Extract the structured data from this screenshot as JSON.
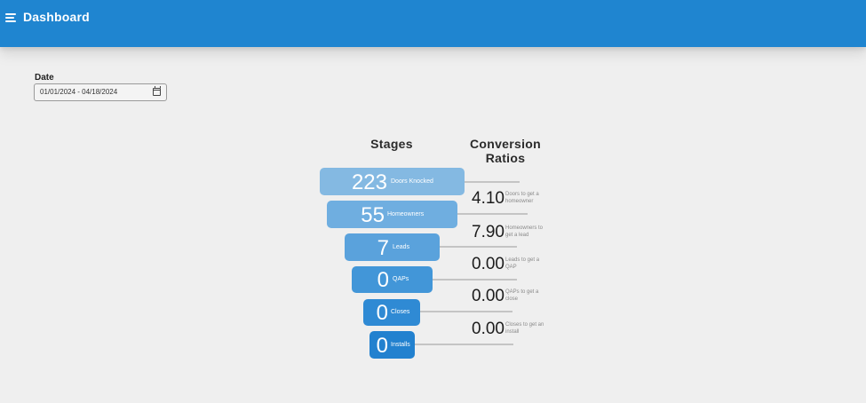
{
  "header": {
    "title": "Dashboard"
  },
  "filter": {
    "date_label": "Date",
    "date_value": "01/01/2024 - 04/18/2024"
  },
  "stages_heading": "Stages",
  "ratios_heading": "Conversion Ratios",
  "stages": [
    {
      "value": "223",
      "label": "Doors Knocked",
      "color": "#84b9e2"
    },
    {
      "value": "55",
      "label": "Homeowners",
      "color": "#6faee0"
    },
    {
      "value": "7",
      "label": "Leads",
      "color": "#5aa2dc"
    },
    {
      "value": "0",
      "label": "QAPs",
      "color": "#4296d8"
    },
    {
      "value": "0",
      "label": "Closes",
      "color": "#2f8ad4"
    },
    {
      "value": "0",
      "label": "Installs",
      "color": "#2281cf"
    }
  ],
  "ratios": [
    {
      "value": "4.10",
      "description": "Doors to get a homeowner"
    },
    {
      "value": "7.90",
      "description": "Homeowners to get a lead"
    },
    {
      "value": "0.00",
      "description": "Leads to get a QAP"
    },
    {
      "value": "0.00",
      "description": "QAPs to get a close"
    },
    {
      "value": "0.00",
      "description": "Closes to get an install"
    }
  ]
}
